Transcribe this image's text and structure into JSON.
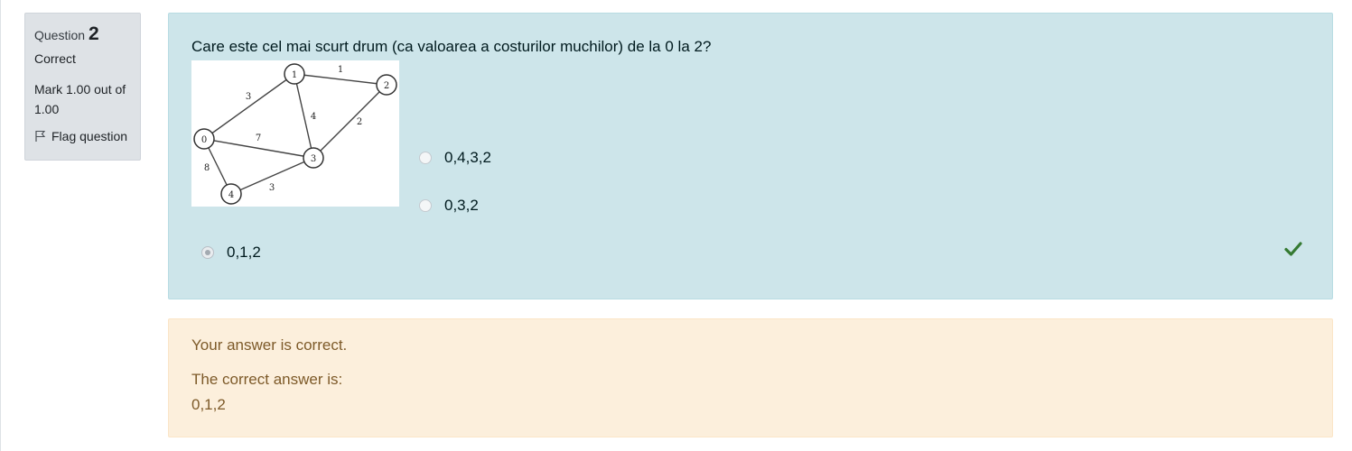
{
  "info": {
    "question_label": "Question",
    "question_number": "2",
    "state": "Correct",
    "grade": "Mark 1.00 out of 1.00",
    "flag_label": "Flag question",
    "flag_icon": "flag-icon"
  },
  "question": {
    "text": "Care este cel mai scurt drum (ca valoarea a costurilor muchilor) de la 0 la 2?",
    "graph": {
      "nodes": [
        "0",
        "1",
        "2",
        "3",
        "4"
      ],
      "edges": [
        {
          "from": "0",
          "to": "1",
          "weight": "3"
        },
        {
          "from": "1",
          "to": "2",
          "weight": "1"
        },
        {
          "from": "1",
          "to": "3",
          "weight": "4"
        },
        {
          "from": "3",
          "to": "2",
          "weight": "2"
        },
        {
          "from": "0",
          "to": "3",
          "weight": "7"
        },
        {
          "from": "0",
          "to": "4",
          "weight": "8"
        },
        {
          "from": "4",
          "to": "3",
          "weight": "3"
        }
      ]
    },
    "options": [
      {
        "label": "0,4,3,2",
        "checked": false
      },
      {
        "label": "0,3,2",
        "checked": false
      },
      {
        "label": "0,1,2",
        "checked": true
      }
    ],
    "correct_icon": "checkmark-icon",
    "correct_color": "#357a32"
  },
  "feedback": {
    "result": "Your answer is correct.",
    "correct_answer_label": "The correct answer is:",
    "correct_answer": "0,1,2"
  },
  "colors": {
    "formulation_bg": "#cde5ea",
    "feedback_bg": "#fcefdc",
    "info_bg": "#dee2e6"
  }
}
